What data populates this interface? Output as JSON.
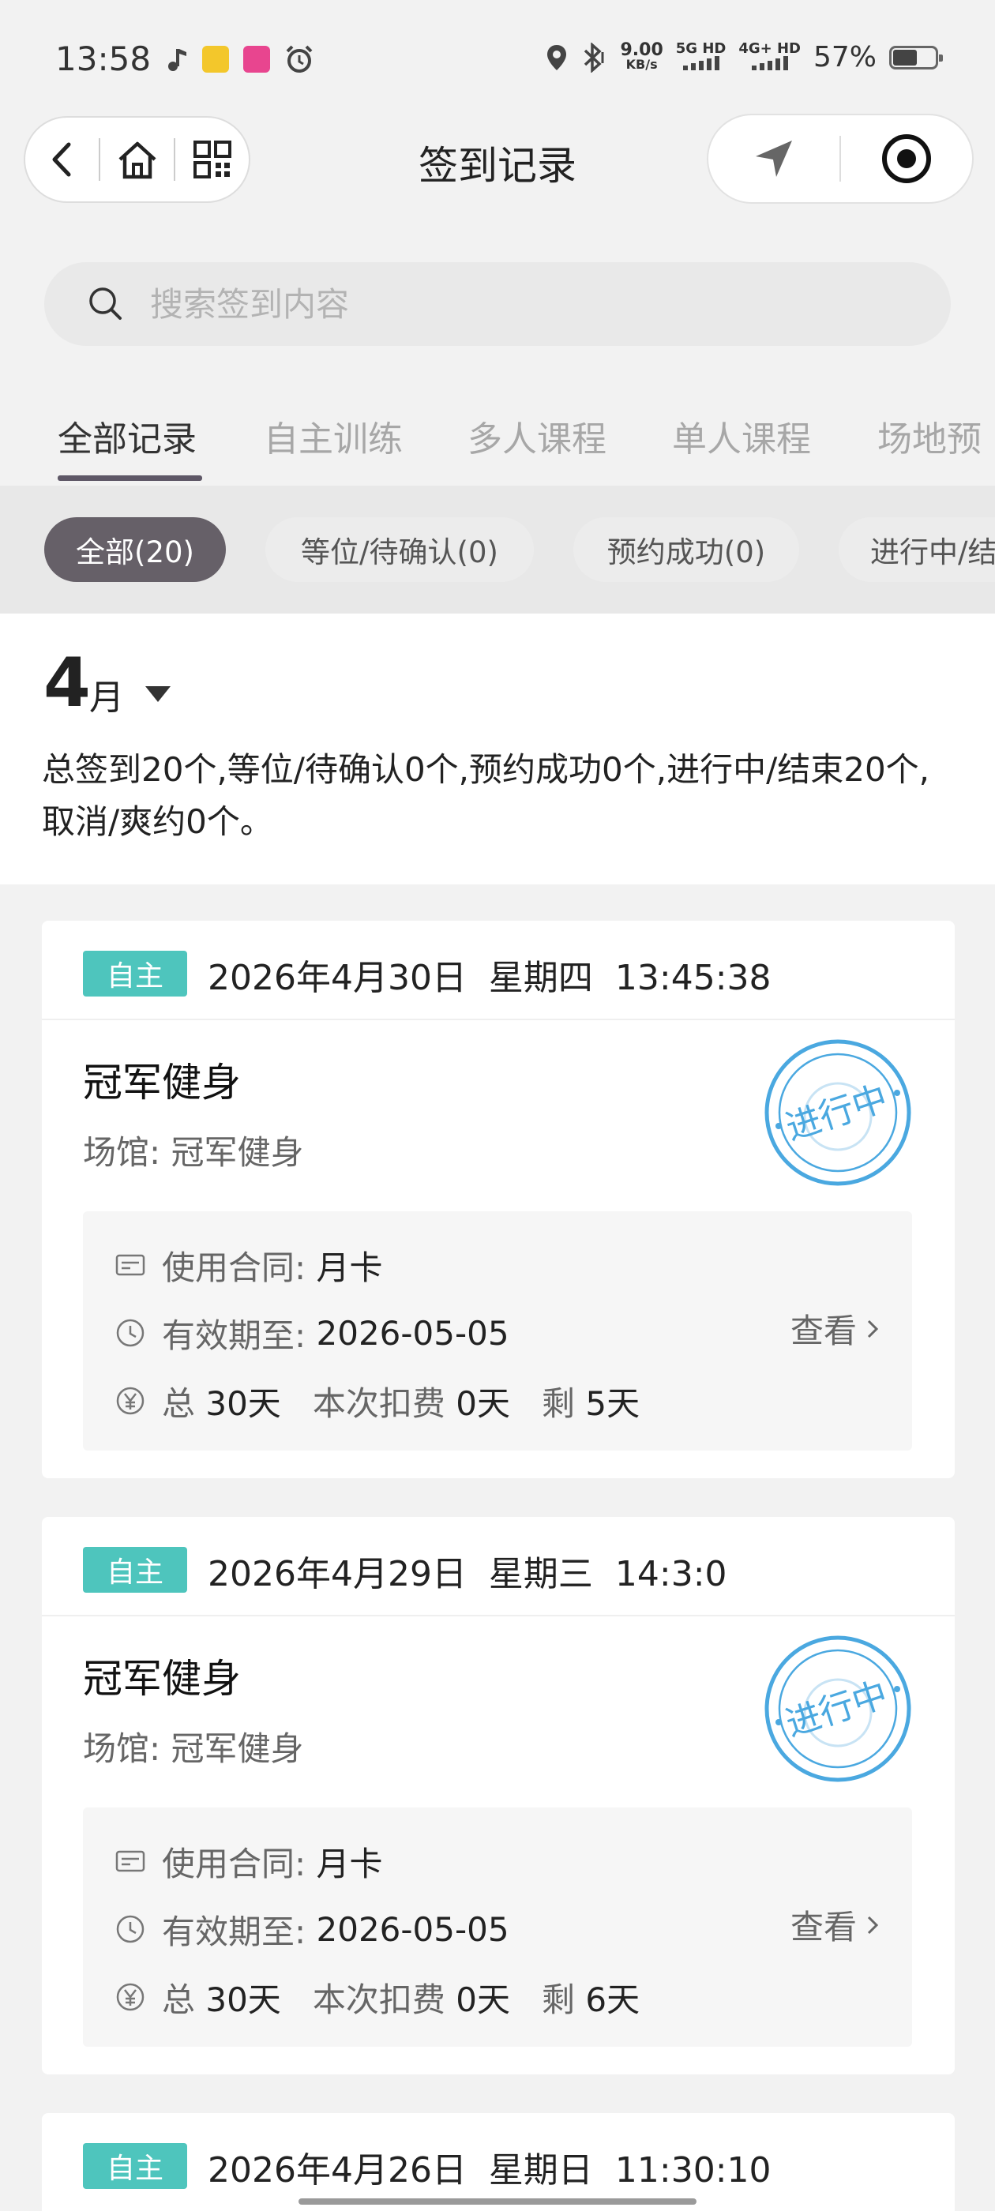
{
  "status_bar": {
    "time": "13:58",
    "net_speed": "9.00",
    "net_unit": "KB/s",
    "sim1": "5G HD",
    "sim2": "4G+ HD",
    "battery": "57%",
    "battery_level": 0.57,
    "icons": [
      "music-note-icon",
      "app-icon-yellow",
      "app-icon-pink",
      "alarm-icon",
      "location-icon",
      "bluetooth-icon"
    ]
  },
  "nav": {
    "title": "签到记录",
    "left_buttons": [
      "back-icon",
      "home-icon",
      "qr-icon"
    ],
    "right_buttons": [
      "navigation-arrow-icon",
      "record-icon"
    ]
  },
  "search": {
    "placeholder": "搜索签到内容"
  },
  "tabs": [
    "全部记录",
    "自主训练",
    "多人课程",
    "单人课程",
    "场地预"
  ],
  "active_tab": 0,
  "filters": [
    "全部(20)",
    "等位/待确认(0)",
    "预约成功(0)",
    "进行中/结"
  ],
  "active_filter": 0,
  "month": {
    "number": "4",
    "unit": "月",
    "summary": "总签到20个,等位/待确认0个,预约成功0个,进行中/结束20个,取消/爽约0个。"
  },
  "colors": {
    "badge": "#4ec5bd",
    "stamp": "#4aa8e0",
    "chip_active": "#666068",
    "tab_underline": "#5f5867"
  },
  "records": [
    {
      "badge": "自主",
      "datetime": "2026年4月30日  星期四  13:45:38",
      "gym": "冠军健身",
      "venue": "场馆:  冠军健身",
      "stamp": "进行中",
      "contract_label": "使用合同: ",
      "contract": "月卡",
      "expiry_label": "有效期至: ",
      "expiry": "2026-05-05",
      "total_label": "总 ",
      "total": "30天",
      "deduct_label": "   本次扣费 ",
      "deduct": "0天",
      "remain_label": "   剩 ",
      "remain": "5天",
      "view": "查看"
    },
    {
      "badge": "自主",
      "datetime": "2026年4月29日  星期三  14:3:0",
      "gym": "冠军健身",
      "venue": "场馆:  冠军健身",
      "stamp": "进行中",
      "contract_label": "使用合同: ",
      "contract": "月卡",
      "expiry_label": "有效期至: ",
      "expiry": "2026-05-05",
      "total_label": "总 ",
      "total": "30天",
      "deduct_label": "   本次扣费 ",
      "deduct": "0天",
      "remain_label": "   剩 ",
      "remain": "6天",
      "view": "查看"
    },
    {
      "badge": "自主",
      "datetime": "2026年4月26日  星期日  11:30:10"
    }
  ]
}
